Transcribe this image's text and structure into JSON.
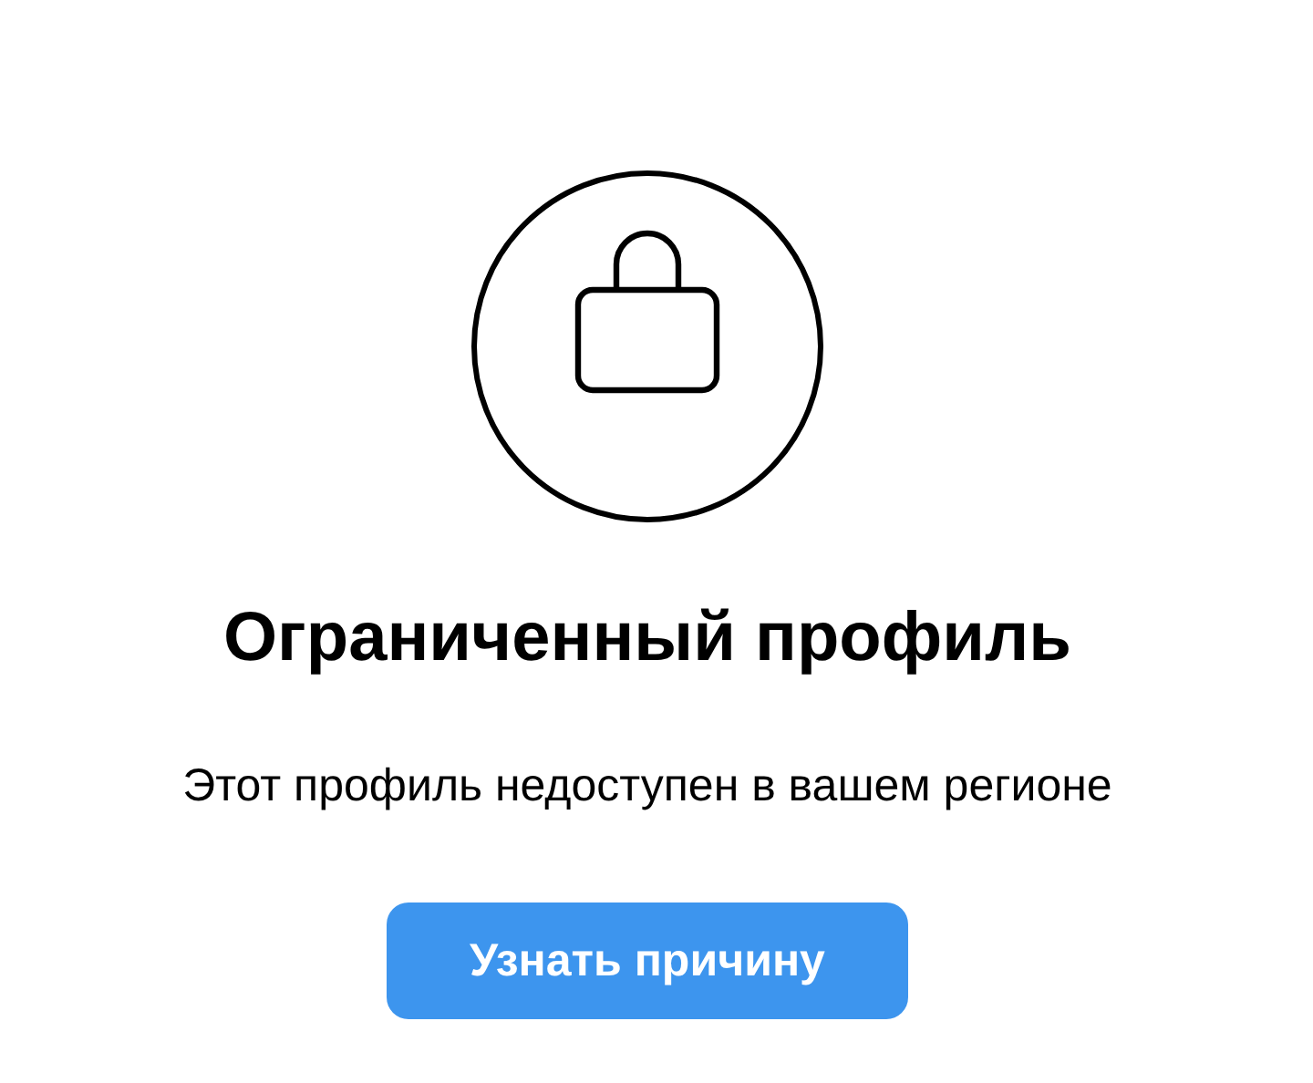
{
  "title": "Ограниченный профиль",
  "message": "Этот профиль недоступен в вашем регионе",
  "button": {
    "label": "Узнать причину"
  }
}
